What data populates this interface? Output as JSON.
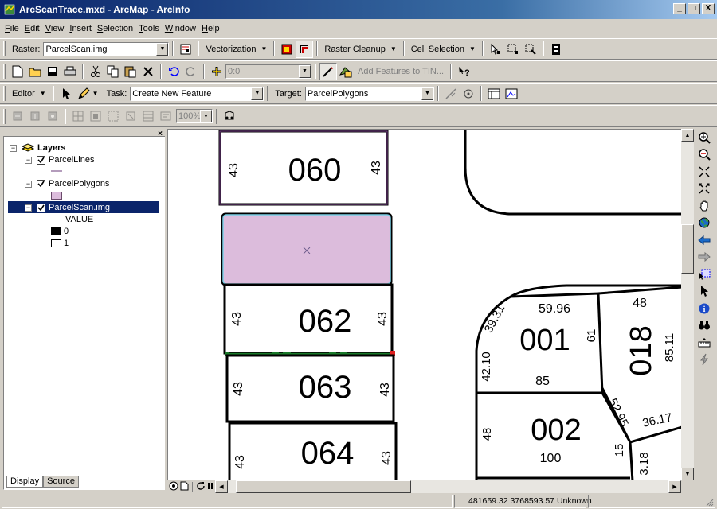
{
  "window": {
    "title": "ArcScanTrace.mxd - ArcMap - ArcInfo",
    "minimize": "_",
    "maximize": "□",
    "close": "X"
  },
  "menu": [
    "File",
    "Edit",
    "View",
    "Insert",
    "Selection",
    "Tools",
    "Window",
    "Help"
  ],
  "raster_toolbar": {
    "label": "Raster:",
    "value": "ParcelScan.img",
    "vectorization": "Vectorization",
    "raster_cleanup": "Raster Cleanup",
    "cell_selection": "Cell Selection"
  },
  "standard_toolbar": {
    "scale_value": "0:0",
    "add_features_tin": "Add Features to TIN..."
  },
  "editor_toolbar": {
    "editor": "Editor",
    "task_label": "Task:",
    "task_value": "Create New Feature",
    "target_label": "Target:",
    "target_value": "ParcelPolygons"
  },
  "topology_toolbar": {
    "zoom_value": "100%"
  },
  "toc": {
    "root": "Layers",
    "layers": [
      {
        "name": "ParcelLines"
      },
      {
        "name": "ParcelPolygons"
      },
      {
        "name": "ParcelScan.img",
        "legend_title": "VALUE",
        "legend": [
          "0",
          "1"
        ]
      }
    ],
    "tabs": [
      "Display",
      "Source"
    ]
  },
  "map": {
    "parcels": [
      "060",
      "062",
      "063",
      "064",
      "001",
      "002",
      "018"
    ],
    "dimensions": [
      "43",
      "43",
      "43",
      "43",
      "43",
      "43",
      "43",
      "43",
      "59.96",
      "39.31",
      "42.10",
      "61",
      "85",
      "48",
      "85.11",
      "36.17",
      "48",
      "52.95",
      "15",
      "100",
      "3.18"
    ]
  },
  "status": {
    "coordinates": "481659.32  3768593.57 Unknown"
  }
}
